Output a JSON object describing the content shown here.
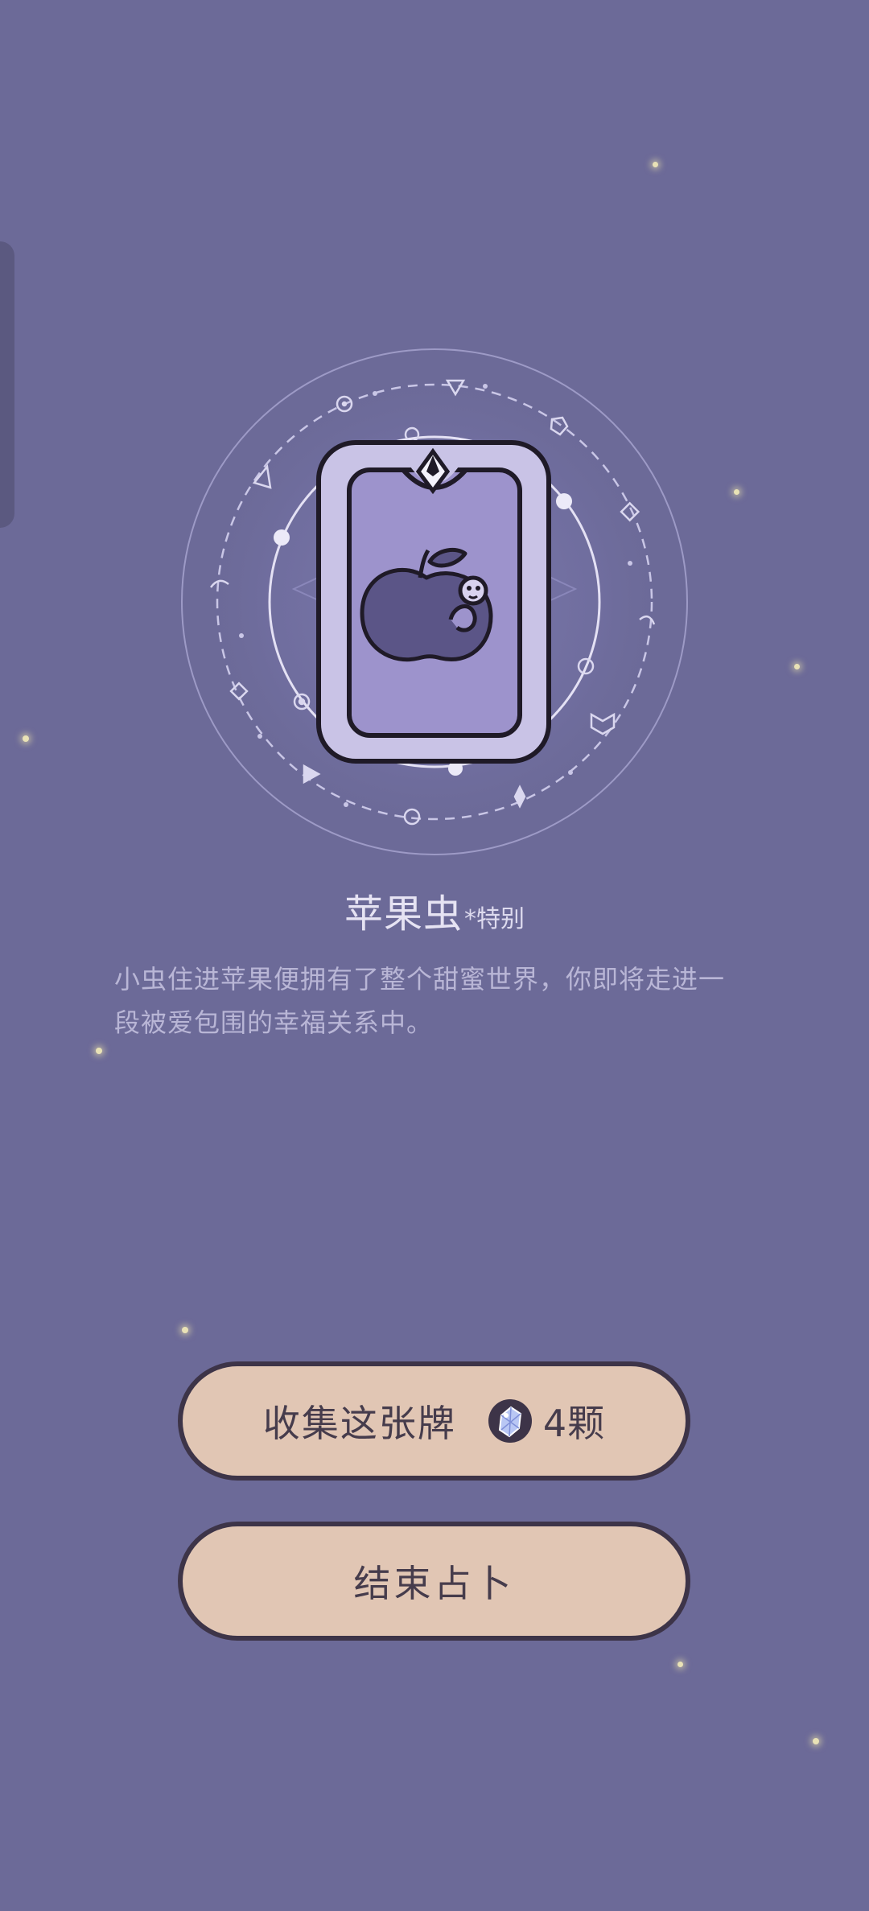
{
  "card": {
    "name": "苹果虫",
    "tag": "*特别",
    "description": "小虫住进苹果便拥有了整个甜蜜世界，你即将走进一段被爱包围的幸福关系中。"
  },
  "actions": {
    "collect_label": "收集这张牌",
    "cost": "4颗",
    "end_label": "结束占卜"
  },
  "colors": {
    "background": "#6c6a98",
    "button_fill": "#e1c6b4",
    "button_border": "#3d3448",
    "card_frame": "#c9c3e6",
    "card_inner": "#9d93cc"
  },
  "icons": {
    "card_art": "apple-worm-icon",
    "cost": "crystal-gem-icon"
  }
}
